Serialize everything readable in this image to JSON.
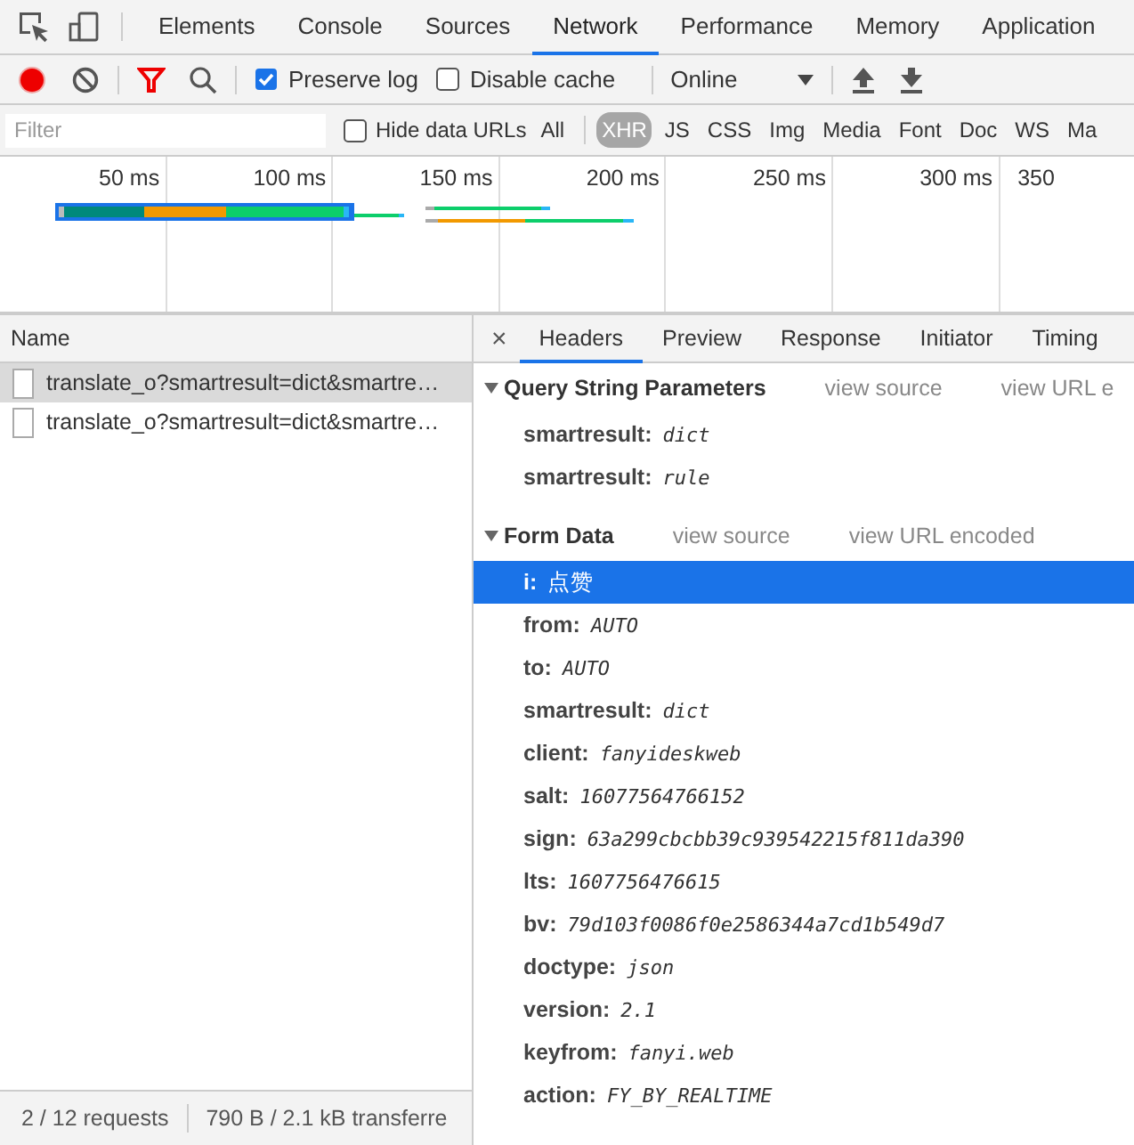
{
  "devtools_tabs": [
    {
      "label": "Elements",
      "selected": false
    },
    {
      "label": "Console",
      "selected": false
    },
    {
      "label": "Sources",
      "selected": false
    },
    {
      "label": "Network",
      "selected": true
    },
    {
      "label": "Performance",
      "selected": false
    },
    {
      "label": "Memory",
      "selected": false
    },
    {
      "label": "Application",
      "selected": false
    }
  ],
  "toolbar": {
    "recording": true,
    "filter_active": true,
    "options": [
      {
        "label": "Preserve log",
        "checked": true
      },
      {
        "label": "Disable cache",
        "checked": false
      }
    ],
    "throttling": "Online"
  },
  "filter_bar": {
    "placeholder": "Filter",
    "hide_data_urls": {
      "label": "Hide data URLs",
      "checked": false
    },
    "types": [
      {
        "label": "All",
        "selected": false
      },
      {
        "label": "XHR",
        "selected": true
      },
      {
        "label": "JS",
        "selected": false
      },
      {
        "label": "CSS",
        "selected": false
      },
      {
        "label": "Img",
        "selected": false
      },
      {
        "label": "Media",
        "selected": false
      },
      {
        "label": "Font",
        "selected": false
      },
      {
        "label": "Doc",
        "selected": false
      },
      {
        "label": "WS",
        "selected": false
      },
      {
        "label": "Ma",
        "selected": false
      }
    ]
  },
  "overview": {
    "ticks": [
      "50 ms",
      "100 ms",
      "150 ms",
      "200 ms",
      "250 ms",
      "300 ms",
      "350"
    ]
  },
  "requests": {
    "header": "Name",
    "rows": [
      {
        "name": "translate_o?smartresult=dict&smartre…",
        "selected": true
      },
      {
        "name": "translate_o?smartresult=dict&smartre…",
        "selected": false
      }
    ]
  },
  "status_bar": {
    "requests": "2 / 12 requests",
    "transferred": "790 B / 2.1 kB transferre"
  },
  "details": {
    "close": "×",
    "tabs": [
      {
        "label": "Headers",
        "selected": true
      },
      {
        "label": "Preview",
        "selected": false
      },
      {
        "label": "Response",
        "selected": false
      },
      {
        "label": "Initiator",
        "selected": false
      },
      {
        "label": "Timing",
        "selected": false
      }
    ],
    "sections": [
      {
        "title": "Query String Parameters",
        "expanded": true,
        "links": [
          "view source",
          "view URL e"
        ],
        "params": [
          {
            "key": "smartresult:",
            "value": "dict",
            "selected": false
          },
          {
            "key": "smartresult:",
            "value": "rule",
            "selected": false
          }
        ]
      },
      {
        "title": "Form Data",
        "expanded": true,
        "links": [
          "view source",
          "view URL encoded"
        ],
        "params": [
          {
            "key": "i:",
            "value": "点赞",
            "selected": true
          },
          {
            "key": "from:",
            "value": "AUTO",
            "selected": false
          },
          {
            "key": "to:",
            "value": "AUTO",
            "selected": false
          },
          {
            "key": "smartresult:",
            "value": "dict",
            "selected": false
          },
          {
            "key": "client:",
            "value": "fanyideskweb",
            "selected": false
          },
          {
            "key": "salt:",
            "value": "16077564766152",
            "selected": false
          },
          {
            "key": "sign:",
            "value": "63a299cbcbb39c939542215f811da390",
            "selected": false
          },
          {
            "key": "lts:",
            "value": "1607756476615",
            "selected": false
          },
          {
            "key": "bv:",
            "value": "79d103f0086f0e2586344a7cd1b549d7",
            "selected": false
          },
          {
            "key": "doctype:",
            "value": "json",
            "selected": false
          },
          {
            "key": "version:",
            "value": "2.1",
            "selected": false
          },
          {
            "key": "keyfrom:",
            "value": "fanyi.web",
            "selected": false
          },
          {
            "key": "action:",
            "value": "FY_BY_REALTIME",
            "selected": false
          }
        ]
      }
    ]
  }
}
